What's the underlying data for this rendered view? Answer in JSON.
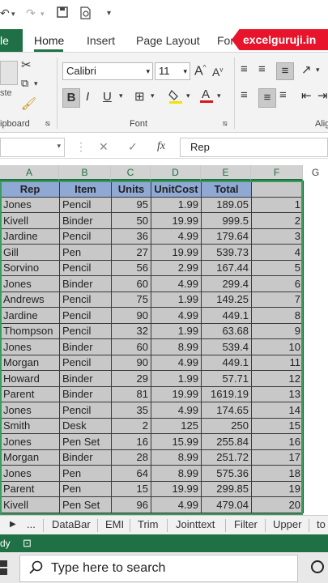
{
  "qat": {
    "icons": [
      "undo-icon",
      "redo-icon",
      "save-icon",
      "print-preview-icon",
      "customize-icon"
    ]
  },
  "tabs": {
    "file": "le",
    "items": [
      "Home",
      "Insert",
      "Page Layout",
      "For"
    ],
    "brand": "excelguruji.in"
  },
  "ribbon": {
    "font_name": "Calibri",
    "font_size": "11",
    "paste_label": "ste",
    "clipboard_label": "ipboard",
    "font_label": "Font",
    "align_label": "Alig",
    "bold": "B",
    "italic": "I",
    "underline": "U",
    "grow": "A",
    "shrink": "A"
  },
  "formula_bar": {
    "fx": "fx",
    "value": "Rep"
  },
  "columns": [
    "A",
    "B",
    "C",
    "D",
    "E",
    "F",
    "G"
  ],
  "table": {
    "headers": [
      "Rep",
      "Item",
      "Units",
      "UnitCost",
      "Total"
    ],
    "rows": [
      [
        "Jones",
        "Pencil",
        "95",
        "1.99",
        "189.05",
        "1"
      ],
      [
        "Kivell",
        "Binder",
        "50",
        "19.99",
        "999.5",
        "2"
      ],
      [
        "Jardine",
        "Pencil",
        "36",
        "4.99",
        "179.64",
        "3"
      ],
      [
        "Gill",
        "Pen",
        "27",
        "19.99",
        "539.73",
        "4"
      ],
      [
        "Sorvino",
        "Pencil",
        "56",
        "2.99",
        "167.44",
        "5"
      ],
      [
        "Jones",
        "Binder",
        "60",
        "4.99",
        "299.4",
        "6"
      ],
      [
        "Andrews",
        "Pencil",
        "75",
        "1.99",
        "149.25",
        "7"
      ],
      [
        "Jardine",
        "Pencil",
        "90",
        "4.99",
        "449.1",
        "8"
      ],
      [
        "Thompson",
        "Pencil",
        "32",
        "1.99",
        "63.68",
        "9"
      ],
      [
        "Jones",
        "Binder",
        "60",
        "8.99",
        "539.4",
        "10"
      ],
      [
        "Morgan",
        "Pencil",
        "90",
        "4.99",
        "449.1",
        "11"
      ],
      [
        "Howard",
        "Binder",
        "29",
        "1.99",
        "57.71",
        "12"
      ],
      [
        "Parent",
        "Binder",
        "81",
        "19.99",
        "1619.19",
        "13"
      ],
      [
        "Jones",
        "Pencil",
        "35",
        "4.99",
        "174.65",
        "14"
      ],
      [
        "Smith",
        "Desk",
        "2",
        "125",
        "250",
        "15"
      ],
      [
        "Jones",
        "Pen Set",
        "16",
        "15.99",
        "255.84",
        "16"
      ],
      [
        "Morgan",
        "Binder",
        "28",
        "8.99",
        "251.72",
        "17"
      ],
      [
        "Jones",
        "Pen",
        "64",
        "8.99",
        "575.36",
        "18"
      ],
      [
        "Parent",
        "Pen",
        "15",
        "19.99",
        "299.85",
        "19"
      ],
      [
        "Kivell",
        "Pen Set",
        "96",
        "4.99",
        "479.04",
        "20"
      ]
    ]
  },
  "sheet_tabs": [
    "...",
    "DataBar",
    "EMI",
    "Trim",
    "Jointtext",
    "Filter",
    "Upper",
    "to"
  ],
  "status": {
    "text": "dy"
  },
  "taskbar": {
    "search_placeholder": "Type here to search"
  }
}
